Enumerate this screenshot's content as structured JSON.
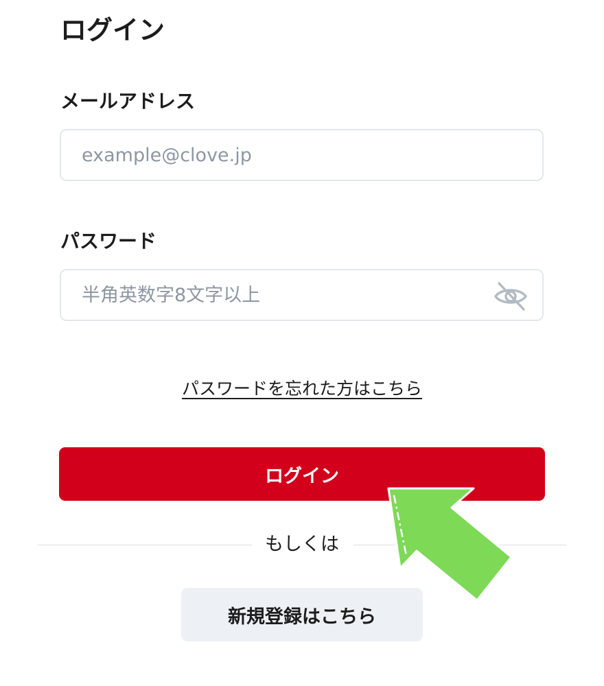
{
  "page": {
    "title": "ログイン"
  },
  "form": {
    "email": {
      "label": "メールアドレス",
      "placeholder": "example@clove.jp",
      "value": ""
    },
    "password": {
      "label": "パスワード",
      "placeholder": "半角英数字8文字以上",
      "value": "",
      "visibility_icon": "eye-slash-icon"
    },
    "forgot_link": "パスワードを忘れた方はこちら",
    "login_button": "ログイン",
    "divider": "もしくは",
    "register_button": "新規登録はこちら"
  },
  "overlay": {
    "arrow_icon": "green-arrow-icon"
  },
  "colors": {
    "primary": "#d3001b",
    "secondary_button_bg": "#edf1f5",
    "input_border": "#e3e7ec",
    "placeholder": "#8d96a2",
    "text": "#1c1c1c",
    "arrow": "#7ed957"
  }
}
